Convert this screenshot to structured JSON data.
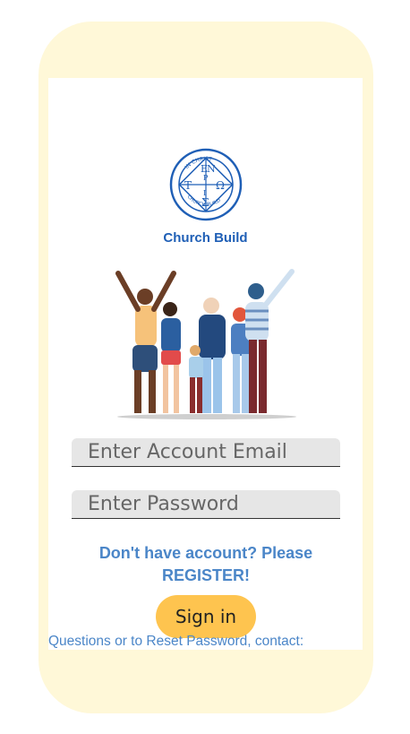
{
  "brand": {
    "name": "Church Build",
    "color": "#1f5fb6"
  },
  "login": {
    "email_placeholder": "Enter Account Email",
    "password_placeholder": "Enter Password",
    "register_text": "Don't have account? Please REGISTER!",
    "signin_label": "Sign in"
  },
  "footer": {
    "text": "Questions or to Reset Password, contact:"
  },
  "colors": {
    "accent": "#fec44f",
    "link": "#4b86c8",
    "frame": "#fff8d8"
  }
}
